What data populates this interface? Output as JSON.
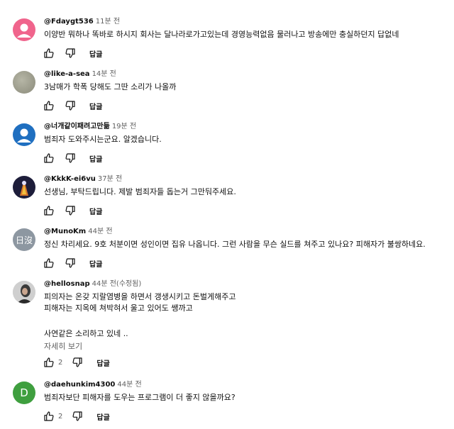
{
  "ui": {
    "reply_label": "답글",
    "more_label": "자세히 보기"
  },
  "comments": [
    {
      "author": "@Fdaygt536",
      "time": "11분 전",
      "lines": [
        "이양반 뭐하나 똑바로 하시지  회사는 달나라로가고있는데 경영능력없음 물러나고 방송에만 충실하던지 답없네"
      ],
      "likes": "",
      "avatar": {
        "type": "default",
        "color": "#f0648c"
      }
    },
    {
      "author": "@like-a-sea",
      "time": "14분 전",
      "lines": [
        "3남매가 학폭 당해도 그딴 소리가 나올까"
      ],
      "likes": "",
      "avatar": {
        "type": "photo",
        "color": "#9a9a88"
      }
    },
    {
      "author": "@너개같이패려고만듦",
      "time": "19분 전",
      "lines": [
        "범죄자 도와주시는군요. 알겠습니다."
      ],
      "likes": "",
      "avatar": {
        "type": "default",
        "color": "#1f6fc0"
      }
    },
    {
      "author": "@KkkK-ei6vu",
      "time": "37분 전",
      "lines": [
        "선생님, 부탁드립니다. 제발 범죄자들 돕는거 그만둬주세요."
      ],
      "likes": "",
      "avatar": {
        "type": "photo",
        "color": "#1d1d3a"
      }
    },
    {
      "author": "@MunoKm",
      "time": "44분 전",
      "lines": [
        "정신 차리세요. 9호 처분이면 성인이면 집유 나옵니다. 그런 사람을 무슨 실드를 쳐주고 있나요? 피해자가 불쌍하네요."
      ],
      "likes": "",
      "avatar": {
        "type": "text",
        "text": "日沒",
        "color": "#8d97a1"
      }
    },
    {
      "author": "@hellosnap",
      "time": "44분 전(수정됨)",
      "lines": [
        "피의자는 온갖 지랄염병을 하면서 갱생시키고 돈벌게해주고",
        "피해자는 지옥에 쳐박혀서 울고 있어도 쌩까고",
        "",
        "사연같은 소리하고 있네 .."
      ],
      "likes": "2",
      "more": true,
      "avatar": {
        "type": "photo",
        "color": "#6a6a6a"
      }
    },
    {
      "author": "@daehunkim4300",
      "time": "44분 전",
      "lines": [
        "범죄자보단 피해자를 도우는 프로그램이 더 좋지 않을까요?"
      ],
      "likes": "2",
      "avatar": {
        "type": "letter",
        "text": "D",
        "color": "#3f9f3f"
      }
    }
  ]
}
